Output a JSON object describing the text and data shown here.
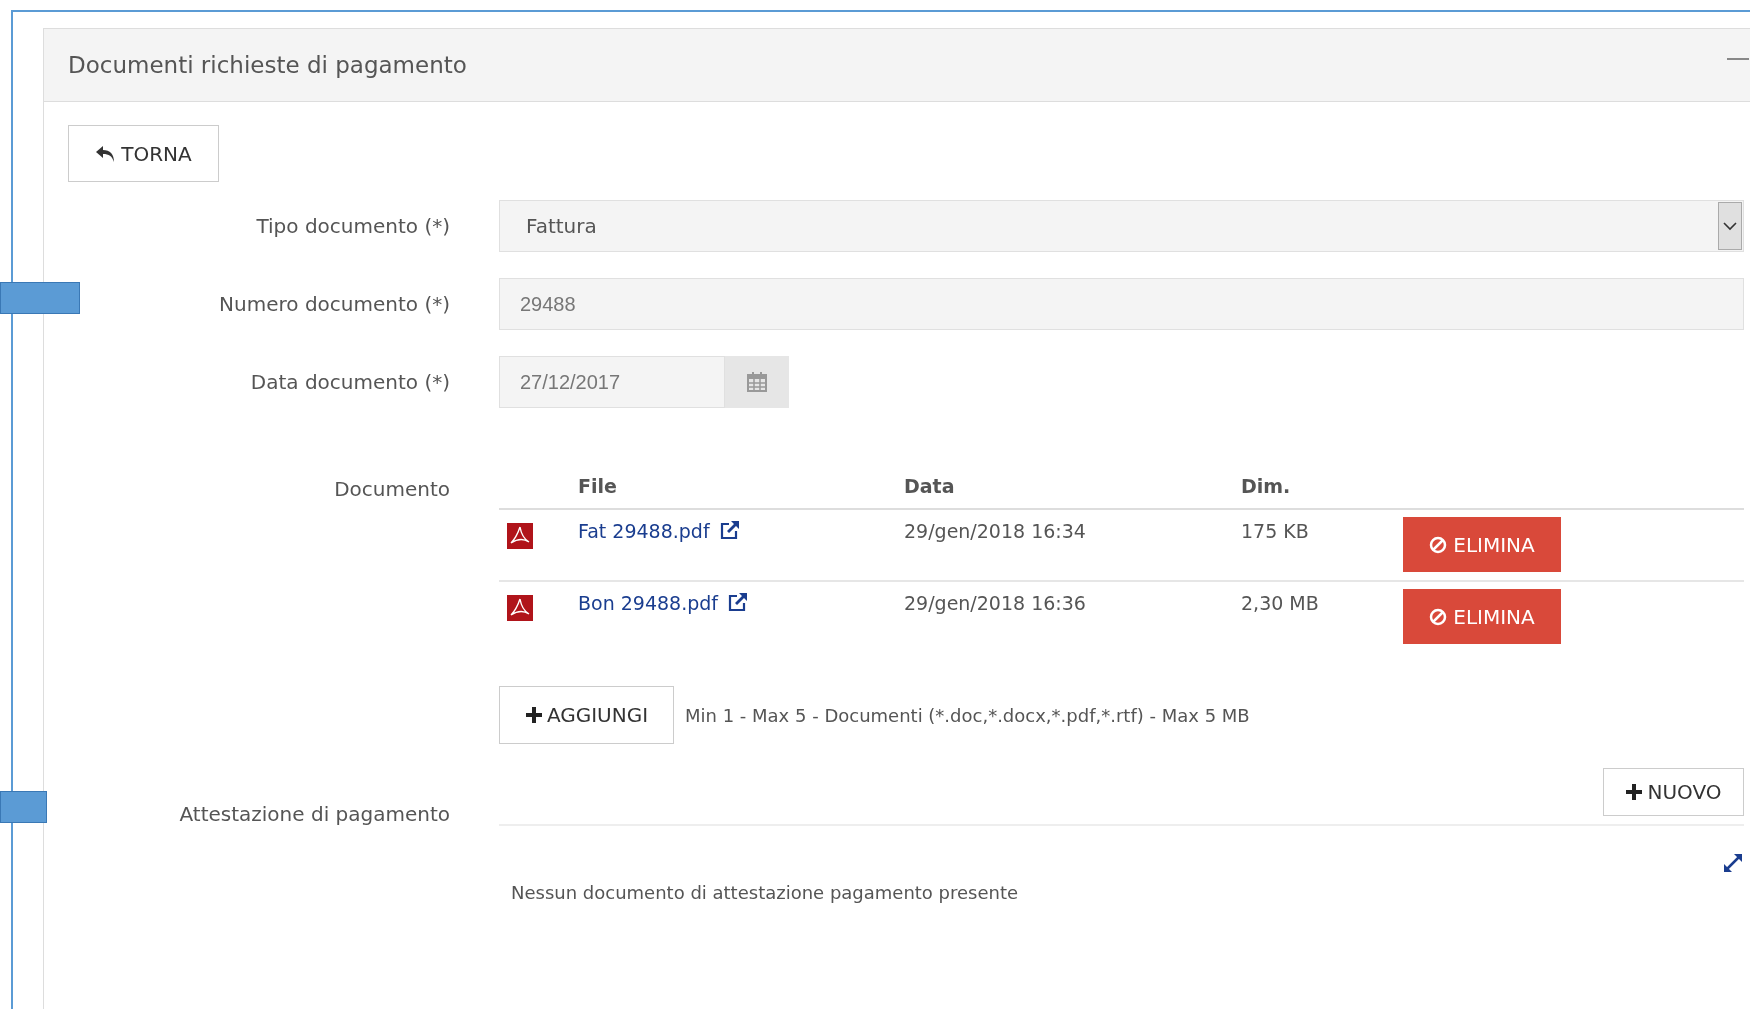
{
  "panel": {
    "title": "Documenti richieste di pagamento"
  },
  "back_button": {
    "label": "TORNA"
  },
  "fields": [
    {
      "kind": "select",
      "label": "Tipo documento (*)",
      "value": "Fattura"
    },
    {
      "kind": "text",
      "label": "Numero documento (*)",
      "value": "29488"
    },
    {
      "kind": "date",
      "label": "Data documento (*)",
      "value": "27/12/2017"
    }
  ],
  "documents": {
    "label": "Documento",
    "columns": [
      "File",
      "Data",
      "Dim."
    ],
    "rows": [
      {
        "file": "Fat 29488.pdf",
        "date": "29/gen/2018 16:34",
        "size": "175 KB",
        "action": "ELIMINA"
      },
      {
        "file": "Bon 29488.pdf",
        "date": "29/gen/2018 16:36",
        "size": "2,30 MB",
        "action": "ELIMINA"
      }
    ],
    "add_button": "AGGIUNGI",
    "hint": "Min 1 - Max 5 - Documenti (*.doc,*.docx,*.pdf,*.rtf) - Max 5 MB"
  },
  "attestation": {
    "label": "Attestazione di pagamento",
    "new_button": "NUOVO",
    "empty_text": "Nessun documento di attestazione pagamento presente"
  }
}
